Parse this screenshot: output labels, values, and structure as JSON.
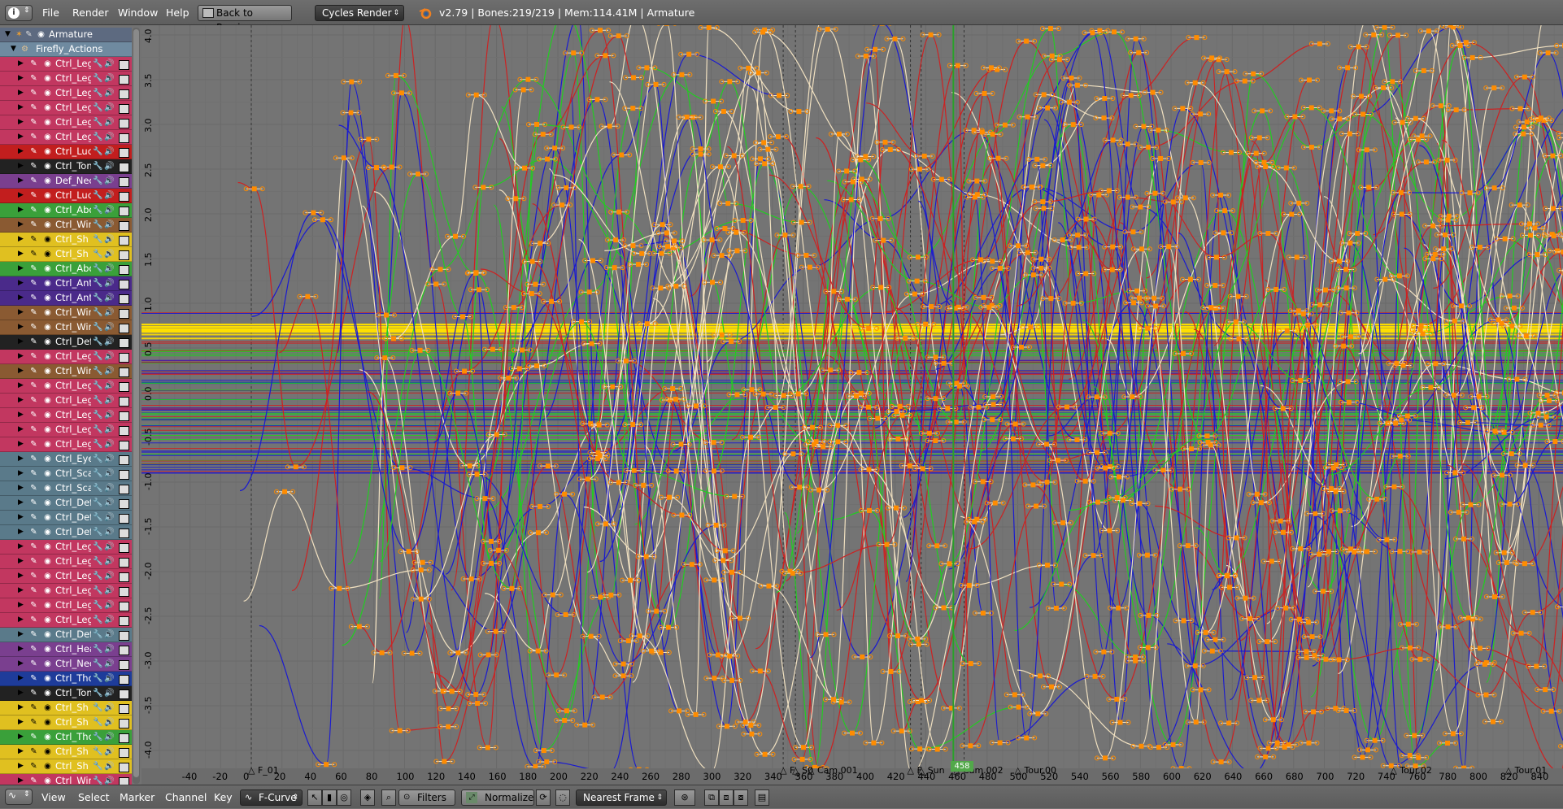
{
  "topbar": {
    "menus": [
      "File",
      "Render",
      "Window",
      "Help"
    ],
    "back_button": "Back to Previous",
    "render_engine": "Cycles Render",
    "stats": "v2.79 | Bones:219/219  | Mem:114.41M | Armature"
  },
  "channels": {
    "armature_label": "Armature",
    "action_label": "Firefly_Actions",
    "rows": [
      {
        "label": "Ctrl_Leg",
        "color": "#c23760"
      },
      {
        "label": "Ctrl_Leg",
        "color": "#c23760"
      },
      {
        "label": "Ctrl_Leg",
        "color": "#c23760"
      },
      {
        "label": "Ctrl_Leg",
        "color": "#c23760"
      },
      {
        "label": "Ctrl_Leg",
        "color": "#c23760"
      },
      {
        "label": "Ctrl_Leg",
        "color": "#c23760"
      },
      {
        "label": "Ctrl_Luc",
        "color": "#c21e1e"
      },
      {
        "label": "Ctrl_Ton",
        "color": "#222222"
      },
      {
        "label": "Def_Nec",
        "color": "#7a3f8f"
      },
      {
        "label": "Ctrl_Luc",
        "color": "#c21e1e"
      },
      {
        "label": "Ctrl_Abd",
        "color": "#3aa03a"
      },
      {
        "label": "Ctrl_Wir",
        "color": "#8a5a32"
      },
      {
        "label": "Ctrl_Sh",
        "color": "#e0c020"
      },
      {
        "label": "Ctrl_Sh",
        "color": "#e0c020"
      },
      {
        "label": "Ctrl_Abd",
        "color": "#3aa03a"
      },
      {
        "label": "Ctrl_Ant",
        "color": "#4a2a8a"
      },
      {
        "label": "Ctrl_Ant",
        "color": "#4a2a8a"
      },
      {
        "label": "Ctrl_Wir",
        "color": "#8a5a32"
      },
      {
        "label": "Ctrl_Wir",
        "color": "#8a5a32"
      },
      {
        "label": "Ctrl_Def",
        "color": "#222222"
      },
      {
        "label": "Ctrl_Leg",
        "color": "#c23760"
      },
      {
        "label": "Ctrl_Wir",
        "color": "#8a5a32"
      },
      {
        "label": "Ctrl_Leg",
        "color": "#c23760"
      },
      {
        "label": "Ctrl_Leg",
        "color": "#c23760"
      },
      {
        "label": "Ctrl_Leg",
        "color": "#c23760"
      },
      {
        "label": "Ctrl_Leg",
        "color": "#c23760"
      },
      {
        "label": "Ctrl_Leg",
        "color": "#c23760"
      },
      {
        "label": "Ctrl_Eye",
        "color": "#5a7a8a"
      },
      {
        "label": "Ctrl_Sca",
        "color": "#5a7a8a"
      },
      {
        "label": "Ctrl_Sca",
        "color": "#5a7a8a"
      },
      {
        "label": "Ctrl_Def",
        "color": "#5a7a8a"
      },
      {
        "label": "Ctrl_Def",
        "color": "#5a7a8a"
      },
      {
        "label": "Ctrl_Def",
        "color": "#5a7a8a"
      },
      {
        "label": "Ctrl_Leg",
        "color": "#c23760"
      },
      {
        "label": "Ctrl_Leg",
        "color": "#c23760"
      },
      {
        "label": "Ctrl_Leg",
        "color": "#c23760"
      },
      {
        "label": "Ctrl_Leg",
        "color": "#c23760"
      },
      {
        "label": "Ctrl_Leg",
        "color": "#c23760"
      },
      {
        "label": "Ctrl_Leg",
        "color": "#c23760"
      },
      {
        "label": "Ctrl_Def",
        "color": "#5a7a8a"
      },
      {
        "label": "Ctrl_Hea",
        "color": "#7a3f8f"
      },
      {
        "label": "Ctrl_Nec",
        "color": "#7a3f8f"
      },
      {
        "label": "Ctrl_Tho",
        "color": "#1e3c9a"
      },
      {
        "label": "Ctrl_Ton",
        "color": "#222222"
      },
      {
        "label": "Ctrl_Sh",
        "color": "#e0c020"
      },
      {
        "label": "Ctrl_Sh",
        "color": "#e0c020"
      },
      {
        "label": "Ctrl_Tho",
        "color": "#3aa03a"
      },
      {
        "label": "Ctrl_Sh",
        "color": "#e0c020"
      },
      {
        "label": "Ctrl_Sh",
        "color": "#e0c020"
      },
      {
        "label": "Ctrl_Wir",
        "color": "#c23760"
      }
    ]
  },
  "graph": {
    "y_ticks": [
      "4.0",
      "3.5",
      "3.0",
      "2.5",
      "2.0",
      "1.5",
      "1.0",
      "0.5",
      "0.0",
      "-0.5",
      "-1.0",
      "-1.5",
      "-2.0",
      "-2.5",
      "-3.0",
      "-3.5",
      "-4.0"
    ],
    "x_ticks": [
      "-40",
      "-20",
      "0",
      "20",
      "40",
      "60",
      "80",
      "100",
      "120",
      "140",
      "160",
      "180",
      "200",
      "220",
      "240",
      "260",
      "280",
      "300",
      "320",
      "340",
      "360",
      "380",
      "400",
      "420",
      "440",
      "460",
      "480",
      "500",
      "520",
      "540",
      "560",
      "580",
      "600",
      "620",
      "640",
      "660",
      "680",
      "700",
      "720",
      "740",
      "760",
      "780",
      "800",
      "820",
      "840"
    ],
    "markers": [
      "F_01",
      "F_",
      "S0",
      "Cam.001",
      "F_",
      "Sun",
      "Cam.002",
      "Tour.00",
      "Tour.01",
      "Tour.02"
    ],
    "current_frame": "458",
    "colors": {
      "x_curve": "#cc2222",
      "y_curve": "#22cc22",
      "z_curve": "#1a1ad0",
      "keyframe": "#ff8c00",
      "handle": "#f0e0c0",
      "selected_line": "#ffe000"
    }
  },
  "bottombar": {
    "menus": [
      "View",
      "Select",
      "Marker",
      "Channel",
      "Key"
    ],
    "mode": "F-Curve",
    "filters": "Filters",
    "normalize": "Normalize",
    "snap": "Nearest Frame"
  }
}
